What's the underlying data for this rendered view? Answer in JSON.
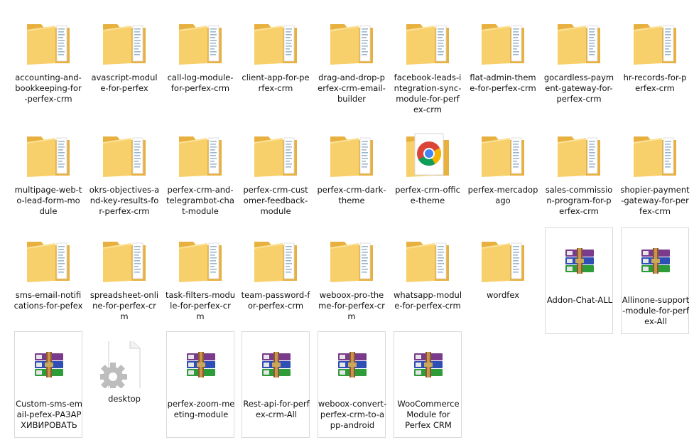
{
  "explorer": {
    "items": [
      {
        "name": "accounting-and-bookkeeping-for-perfex-crm",
        "lines": [
          "accounting-and-",
          "bookkeeping-for",
          "-perfex-crm"
        ],
        "icon": "folder-icon"
      },
      {
        "name": "avascript-module-for-perfex",
        "lines": [
          "avascript-modul",
          "e-for-perfex"
        ],
        "icon": "folder-icon"
      },
      {
        "name": "call-log-module-for-perfex-crm",
        "lines": [
          "call-log-module-",
          "for-perfex-crm"
        ],
        "icon": "folder-icon"
      },
      {
        "name": "client-app-for-perfex-crm",
        "lines": [
          "client-app-for-pe",
          "rfex-crm"
        ],
        "icon": "folder-icon"
      },
      {
        "name": "drag-and-drop-perfex-crm-email-builder",
        "lines": [
          "drag-and-drop-p",
          "erfex-crm-email-",
          "builder"
        ],
        "icon": "folder-icon"
      },
      {
        "name": "facebook-leads-integration-sync-module-for-perfex-crm",
        "lines": [
          "facebook-leads-i",
          "ntegration-sync-",
          "module-for-perf",
          "ex-crm"
        ],
        "icon": "folder-icon"
      },
      {
        "name": "flat-admin-theme-for-perfex-crm",
        "lines": [
          "flat-admin-them",
          "e-for-perfex-crm"
        ],
        "icon": "folder-icon"
      },
      {
        "name": "gocardless-payment-gateway-for-perfex-crm",
        "lines": [
          "gocardless-paym",
          "ent-gateway-for-",
          "perfex-crm"
        ],
        "icon": "folder-icon"
      },
      {
        "name": "hr-records-for-perfex-crm",
        "lines": [
          "hr-records-for-p",
          "erfex-crm"
        ],
        "icon": "folder-icon"
      },
      {
        "name": "multipage-web-to-lead-form-module",
        "lines": [
          "multipage-web-t",
          "o-lead-form-mo",
          "dule"
        ],
        "icon": "folder-icon"
      },
      {
        "name": "okrs-objectives-and-key-results-for-perfex-crm",
        "lines": [
          "okrs-objectives-a",
          "nd-key-results-fo",
          "r-perfex-crm"
        ],
        "icon": "folder-icon"
      },
      {
        "name": "perfex-crm-and-telegrambot-chat-module",
        "lines": [
          "perfex-crm-and-",
          "telegrambot-cha",
          "t-module"
        ],
        "icon": "folder-icon"
      },
      {
        "name": "perfex-crm-customer-feedback-module",
        "lines": [
          "perfex-crm-cust",
          "omer-feedback-",
          "module"
        ],
        "icon": "folder-icon"
      },
      {
        "name": "perfex-crm-dark-theme",
        "lines": [
          "perfex-crm-dark-",
          "theme"
        ],
        "icon": "folder-icon"
      },
      {
        "name": "perfex-crm-office-theme",
        "lines": [
          "perfex-crm-offic",
          "e-theme"
        ],
        "icon": "chrome-icon"
      },
      {
        "name": "perfex-mercadopago",
        "lines": [
          "perfex-mercadop",
          "ago"
        ],
        "icon": "folder-icon"
      },
      {
        "name": "sales-commission-program-for-perfex-crm",
        "lines": [
          "sales-commissio",
          "n-program-for-p",
          "erfex-crm"
        ],
        "icon": "folder-icon"
      },
      {
        "name": "shopier-payment-gateway-for-perfex-crm",
        "lines": [
          "shopier-payment",
          "-gateway-for-per",
          "fex-crm"
        ],
        "icon": "folder-icon"
      },
      {
        "name": "sms-email-notifications-for-pefex",
        "lines": [
          "sms-email-notifi",
          "cations-for-pefex"
        ],
        "icon": "folder-icon"
      },
      {
        "name": "spreadsheet-online-for-perfex-crm",
        "lines": [
          "spreadsheet-onli",
          "ne-for-perfex-cr",
          "m"
        ],
        "icon": "folder-icon"
      },
      {
        "name": "task-filters-module-for-perfex-crm",
        "lines": [
          "task-filters-modu",
          "le-for-perfex-cr",
          "m"
        ],
        "icon": "folder-icon"
      },
      {
        "name": "team-password-for-perfex-crm",
        "lines": [
          "team-password-f",
          "or-perfex-crm"
        ],
        "icon": "folder-icon"
      },
      {
        "name": "weboox-pro-theme-for-perfex-crm",
        "lines": [
          "weboox-pro-the",
          "me-for-perfex-cr",
          "m"
        ],
        "icon": "folder-icon"
      },
      {
        "name": "whatsapp-module-for-perfex-crm",
        "lines": [
          "whatsapp-modul",
          "e-for-perfex-crm"
        ],
        "icon": "folder-icon"
      },
      {
        "name": "wordfex",
        "lines": [
          "wordfex"
        ],
        "icon": "folder-icon"
      },
      {
        "name": "Addon-Chat-ALL",
        "lines": [
          "Addon-Chat-ALL"
        ],
        "icon": "winrar-archive-icon"
      },
      {
        "name": "Allinone-support-module-for-perfex-All",
        "lines": [
          "Allinone-support",
          "-module-for-perf",
          "ex-All"
        ],
        "icon": "winrar-archive-icon"
      },
      {
        "name": "Custom-sms-email-pefex-РАЗАРХИВИРОВАТЬ",
        "lines": [
          "Custom-sms-em",
          "ail-pefex-РАЗАР",
          "ХИВИРОВАТЬ"
        ],
        "icon": "winrar-archive-icon"
      },
      {
        "name": "desktop",
        "lines": [
          "desktop"
        ],
        "icon": "settings-file-icon"
      },
      {
        "name": "perfex-zoom-meeting-module",
        "lines": [
          "perfex-zoom-me",
          "eting-module"
        ],
        "icon": "winrar-archive-icon"
      },
      {
        "name": "Rest-api-for-perfex-crm-All",
        "lines": [
          "Rest-api-for-perf",
          "ex-crm-All"
        ],
        "icon": "winrar-archive-icon"
      },
      {
        "name": "weboox-convert-perfex-crm-to-app-android",
        "lines": [
          "weboox-convert-",
          "perfex-crm-to-a",
          "pp-android"
        ],
        "icon": "winrar-archive-icon"
      },
      {
        "name": "WooCommerce Module for Perfex CRM",
        "lines": [
          "WooCommerce",
          "Module for",
          "Perfex CRM"
        ],
        "icon": "winrar-archive-icon"
      }
    ]
  },
  "colors": {
    "folder_back": "#e8b13f",
    "folder_front": "#f8d06b",
    "paper": "#ffffff",
    "tile_border": "#d9d9d9",
    "text": "#111111"
  }
}
